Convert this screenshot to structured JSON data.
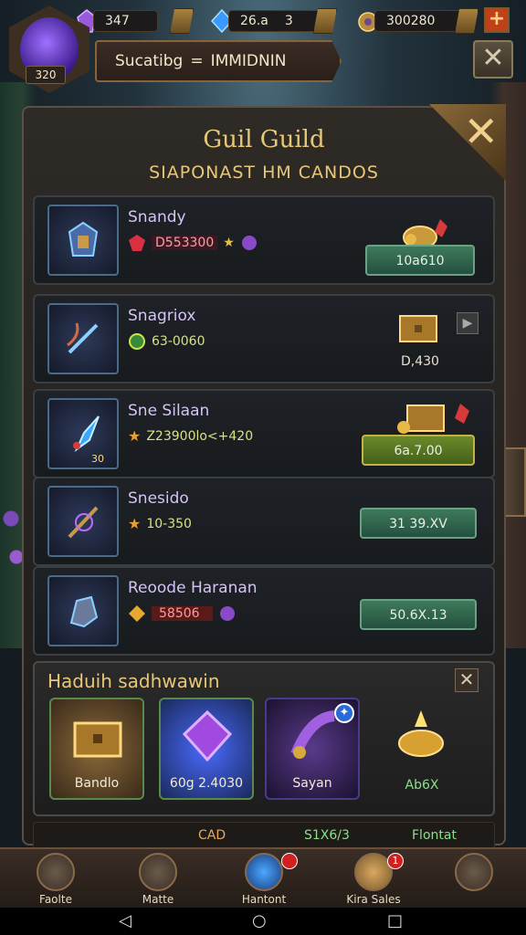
{
  "resources": [
    {
      "value": "347",
      "icon": "purple-crystal-icon"
    },
    {
      "value": "26.a",
      "extra": "3",
      "icon": "blue-gem-icon"
    },
    {
      "value": "300280",
      "icon": "gold-coin-pouch-icon"
    }
  ],
  "player": {
    "level": "320"
  },
  "banner": {
    "left": "Sucatibg",
    "sep": "=",
    "right": "IMMIDNIN"
  },
  "panel": {
    "title": "Guil Guild",
    "subtitle": "SIAPONAST HM CANDOS"
  },
  "items": [
    {
      "name": "Snandy",
      "stat": "D553300",
      "price": "10a610",
      "price_style": "green"
    },
    {
      "name": "Snagriox",
      "stat": "63-0060",
      "price": "D,430",
      "price_style": "plain"
    },
    {
      "name": "Sne Silaan",
      "thumb_level": "30",
      "stat": "Z23900lo<+420",
      "price": "6a.7.00",
      "price_style": "gold"
    },
    {
      "name": "Snesido",
      "stat": "10-350",
      "price": "31 39.XV",
      "price_style": "green"
    },
    {
      "name": "Reoode Haranan",
      "stat": "58506",
      "price": "50.6X.13",
      "price_style": "green"
    }
  ],
  "section2": {
    "title": "Haduih sadhwawin",
    "cards": [
      {
        "label": "Bandlo",
        "icon": "treasure-chest-icon"
      },
      {
        "label": "60g 2.4030",
        "icon": "purple-crystal-icon"
      },
      {
        "label": "Sayan",
        "icon": "scroll-icon"
      },
      {
        "label": "Ab6X",
        "icon": "golden-lamp-icon"
      }
    ]
  },
  "strip": {
    "left": "CAD",
    "mid": "S1X6/3",
    "right": "Flontat"
  },
  "nav": [
    {
      "label": "Faolte",
      "icon": "quill-icon"
    },
    {
      "label": "Matte",
      "icon": "swords-icon"
    },
    {
      "label": "Hantont",
      "icon": "crystal-orb-icon",
      "badge": ""
    },
    {
      "label": "Kira Sales",
      "icon": "coin-bag-icon",
      "badge": "1"
    },
    {
      "label": "",
      "icon": "settings-shield-icon"
    }
  ],
  "colors": {
    "accent_gold": "#e8c878",
    "panel_bg": "#2e2a26",
    "price_green": "#3e7a5a"
  }
}
